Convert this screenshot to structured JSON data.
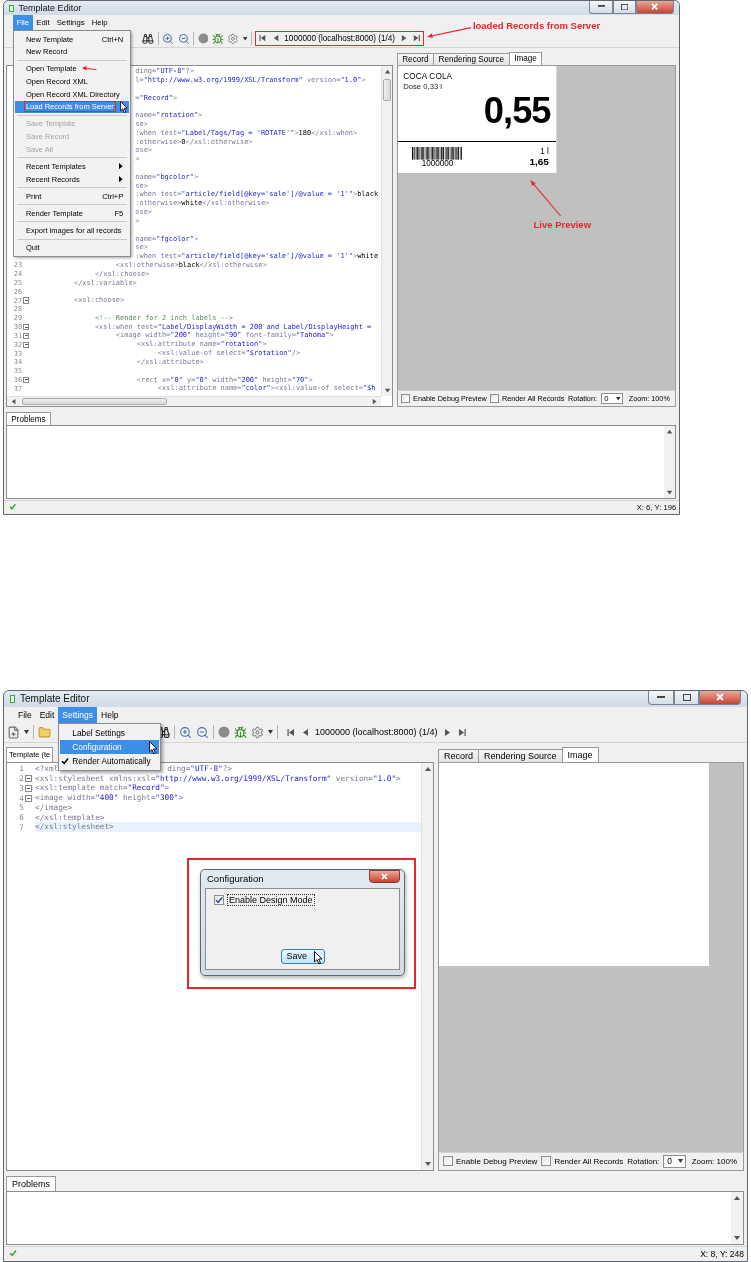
{
  "screenshots": [
    {
      "window": {
        "title": "Template Editor"
      },
      "menu_bar": [
        {
          "label": "File",
          "selected": true
        },
        {
          "label": "Edit",
          "selected": false
        },
        {
          "label": "Settings",
          "selected": false
        },
        {
          "label": "Help",
          "selected": false
        }
      ],
      "open_menu": [
        {
          "kind": "item",
          "label": "New Template",
          "shortcut": "Ctrl+N",
          "disabled": false,
          "highlighted": false,
          "submenu": false,
          "boxed": false,
          "arrowed": false
        },
        {
          "kind": "item",
          "label": "New Record",
          "disabled": false,
          "highlighted": false,
          "submenu": false,
          "boxed": false,
          "arrowed": false
        },
        {
          "kind": "separator"
        },
        {
          "kind": "item",
          "label": "Open Template",
          "disabled": false,
          "highlighted": false,
          "submenu": false,
          "boxed": false,
          "arrowed": true
        },
        {
          "kind": "item",
          "label": "Open Record XML",
          "disabled": false,
          "highlighted": false,
          "submenu": false,
          "boxed": false,
          "arrowed": false
        },
        {
          "kind": "item",
          "label": "Open Record XML Directory",
          "disabled": false,
          "highlighted": false,
          "submenu": false,
          "boxed": false,
          "arrowed": false
        },
        {
          "kind": "item",
          "label": "Load Records from Server",
          "disabled": false,
          "highlighted": true,
          "submenu": false,
          "boxed": true,
          "arrowed": false
        },
        {
          "kind": "separator"
        },
        {
          "kind": "item",
          "label": "Save Template",
          "disabled": true,
          "highlighted": false,
          "submenu": false,
          "boxed": false,
          "arrowed": false
        },
        {
          "kind": "item",
          "label": "Save Record",
          "disabled": true,
          "highlighted": false,
          "submenu": false,
          "boxed": false,
          "arrowed": false
        },
        {
          "kind": "item",
          "label": "Save All",
          "disabled": true,
          "highlighted": false,
          "submenu": false,
          "boxed": false,
          "arrowed": false
        },
        {
          "kind": "separator"
        },
        {
          "kind": "item",
          "label": "Recent Templates",
          "disabled": false,
          "highlighted": false,
          "submenu": true,
          "boxed": false,
          "arrowed": false
        },
        {
          "kind": "item",
          "label": "Recent Records",
          "disabled": false,
          "highlighted": false,
          "submenu": true,
          "boxed": false,
          "arrowed": false
        },
        {
          "kind": "separator"
        },
        {
          "kind": "item",
          "label": "Print",
          "shortcut": "Ctrl+P",
          "disabled": false,
          "highlighted": false,
          "submenu": false,
          "boxed": false,
          "arrowed": false
        },
        {
          "kind": "separator"
        },
        {
          "kind": "item",
          "label": "Render Template",
          "shortcut": "F5",
          "disabled": false,
          "highlighted": false,
          "submenu": false,
          "boxed": false,
          "arrowed": false
        },
        {
          "kind": "separator"
        },
        {
          "kind": "item",
          "label": "Export images for all records",
          "disabled": false,
          "highlighted": false,
          "submenu": false,
          "boxed": false,
          "arrowed": false
        },
        {
          "kind": "separator"
        },
        {
          "kind": "item",
          "label": "Quit",
          "disabled": false,
          "highlighted": false,
          "submenu": false,
          "boxed": false,
          "arrowed": false
        }
      ],
      "toolbar": {
        "file_tools_visible": false,
        "navigator": "1000000 (localhost:8000) (1/4)",
        "navigator_marked": true
      },
      "editor": {
        "scrollable": true,
        "lines": [
          {
            "kind": "covered",
            "text": "ding=\"UTF-8\"?>"
          },
          {
            "kind": "covered",
            "text": "l=\"http://www.w3.org/1999/XSL/Transform\" version=\"1.0\">"
          },
          {
            "kind": "covered"
          },
          {
            "kind": "covered",
            "text": "=\"Record\">"
          },
          {
            "kind": "covered"
          },
          {
            "kind": "covered",
            "text": "name=\"rotation\">"
          },
          {
            "kind": "covered",
            "text": "se>"
          },
          {
            "kind": "covered",
            "text": ":when test=\"Label/Tags/Tag = 'ROTATE'\">180</xsl:when>"
          },
          {
            "kind": "covered",
            "text": ":otherwise>0</xsl:otherwise>"
          },
          {
            "kind": "covered",
            "text": "ose>"
          },
          {
            "kind": "covered",
            "text": ">"
          },
          {
            "kind": "covered"
          },
          {
            "kind": "covered",
            "text": "name=\"bgcolor\">"
          },
          {
            "kind": "covered",
            "text": "se>"
          },
          {
            "kind": "covered",
            "text": ":when test=\"article/field[@key='sale']/@value = '1'\">black"
          },
          {
            "kind": "covered",
            "text": ":otherwise>white</xsl:otherwise>"
          },
          {
            "kind": "covered",
            "text": "ose>"
          },
          {
            "kind": "covered",
            "text": ">"
          },
          {
            "kind": "covered"
          },
          {
            "kind": "covered",
            "text": "name=\"fgcolor\">"
          },
          {
            "kind": "covered",
            "text": "se>"
          },
          {
            "kind": "covered",
            "text": ":when test=\"article/field[@key='sale']/@value = '1'\">white"
          },
          {
            "kind": "full",
            "number": "23",
            "fold": false,
            "text": "                    <xsl:otherwise>black</xsl:otherwise>"
          },
          {
            "kind": "full",
            "number": "24",
            "fold": false,
            "text": "               </xsl:choose>"
          },
          {
            "kind": "full",
            "number": "25",
            "fold": false,
            "text": "          </xsl:variable>"
          },
          {
            "kind": "full",
            "number": "26",
            "fold": false
          },
          {
            "kind": "full",
            "number": "27",
            "fold": true,
            "text": "          <xsl:choose>"
          },
          {
            "kind": "full",
            "number": "28",
            "fold": false
          },
          {
            "kind": "full",
            "number": "29",
            "fold": false,
            "text": "               <!-- Render for 2 inch labels -->"
          },
          {
            "kind": "full",
            "number": "30",
            "fold": true,
            "text": "               <xsl:when test=\"Label/DisplayWidth = 200 and Label/DisplayHeight ="
          },
          {
            "kind": "full",
            "number": "31",
            "fold": true,
            "text": "                    <image width=\"200\" height=\"90\" font-family=\"Tahoma\">"
          },
          {
            "kind": "full",
            "number": "32",
            "fold": true,
            "text": "                         <xsl:attribute name=\"rotation\">"
          },
          {
            "kind": "full",
            "number": "33",
            "fold": false,
            "text": "                              <xsl:value-of select=\"$rotation\"/>"
          },
          {
            "kind": "full",
            "number": "34",
            "fold": false,
            "text": "                         </xsl:attribute>"
          },
          {
            "kind": "full",
            "number": "35",
            "fold": false
          },
          {
            "kind": "full",
            "number": "36",
            "fold": true,
            "text": "                         <rect x=\"0\" y=\"0\" width=\"200\" height=\"70\">"
          },
          {
            "kind": "full",
            "number": "37",
            "fold": false,
            "text": "                              <xsl:attribute name=\"color\"><xsl:value-of select=\"$h"
          }
        ]
      },
      "preview": {
        "tabs": [
          {
            "label": "Record",
            "selected": false
          },
          {
            "label": "Rendering Source",
            "selected": false
          },
          {
            "label": "Image",
            "selected": true
          }
        ],
        "content": {
          "kind": "label",
          "title": "COCA COLA",
          "subtitle": "Dose 0,33 l",
          "price": "0,55",
          "barcode": "1000000",
          "unit": "1 l",
          "unit_price": "1,65"
        },
        "options": [
          {
            "label": "Enable Debug Preview",
            "checked": false
          },
          {
            "label": "Render All Records",
            "checked": false
          }
        ],
        "rotation_label": "Rotation:",
        "rotation": "0",
        "zoom": "Zoom: 100%"
      },
      "problems": {
        "tab": "Problems"
      },
      "status_bar": {
        "ok": true,
        "position": "X: 6, Y: 196"
      },
      "annotations": [
        {
          "kind": "navigator-callout",
          "text": "loaded Records from Server"
        },
        {
          "kind": "preview-callout",
          "text": "Live Preview"
        }
      ]
    },
    {
      "window": {
        "title": "Template Editor"
      },
      "menu_bar": [
        {
          "label": "File",
          "selected": false
        },
        {
          "label": "Edit",
          "selected": false
        },
        {
          "label": "Settings",
          "selected": true
        },
        {
          "label": "Help",
          "selected": false
        }
      ],
      "open_menu": [
        {
          "kind": "item",
          "label": "Label Settings",
          "highlighted": false,
          "checked": false
        },
        {
          "kind": "item",
          "label": "Configuration",
          "highlighted": true,
          "checked": false
        },
        {
          "kind": "item",
          "label": "Render Automatically",
          "highlighted": false,
          "checked": true
        }
      ],
      "toolbar": {
        "file_tools_visible": true,
        "navigator": "1000000 (localhost:8000) (1/4)",
        "navigator_marked": false
      },
      "editor": {
        "tab": "Template (te",
        "scrollable": false,
        "lines": [
          {
            "kind": "split",
            "number": "1",
            "fold": false,
            "current": false,
            "text": "<?xml",
            "tail": "ding=\"UTF-8\"?>"
          },
          {
            "kind": "full",
            "number": "2",
            "fold": true,
            "current": false,
            "text": "<xsl:stylesheet xmlns:xsl=\"http://www.w3.org/1999/XSL/Transform\" version=\"1.0\">"
          },
          {
            "kind": "full",
            "number": "3",
            "fold": true,
            "current": false,
            "text": "<xsl:template match=\"Record\">"
          },
          {
            "kind": "full",
            "number": "4",
            "fold": true,
            "current": false,
            "text": "<image width=\"400\" height=\"300\">"
          },
          {
            "kind": "full",
            "number": "5",
            "fold": false,
            "current": false,
            "text": "</image>"
          },
          {
            "kind": "full",
            "number": "6",
            "fold": false,
            "current": false,
            "text": "</xsl:template>"
          },
          {
            "kind": "full",
            "number": "7",
            "fold": false,
            "current": true,
            "text": "</xsl:stylesheet>"
          }
        ]
      },
      "preview": {
        "tabs": [
          {
            "label": "Record",
            "selected": false
          },
          {
            "label": "Rendering Source",
            "selected": false
          },
          {
            "label": "Image",
            "selected": true
          }
        ],
        "content": {
          "kind": "blank"
        },
        "options": [
          {
            "label": "Enable Debug Preview",
            "checked": false
          },
          {
            "label": "Render All Records",
            "checked": false
          }
        ],
        "rotation_label": "Rotation:",
        "rotation": "0",
        "zoom": "Zoom: 100%"
      },
      "problems": {
        "tab": "Problems"
      },
      "status_bar": {
        "ok": true,
        "position": "X: 8, Y: 248"
      },
      "dialog": {
        "title": "Configuration",
        "marked": true,
        "checkbox": {
          "label": "Enable Design Mode",
          "checked": true
        },
        "button": {
          "label": "Save",
          "hovered": true
        }
      }
    }
  ]
}
